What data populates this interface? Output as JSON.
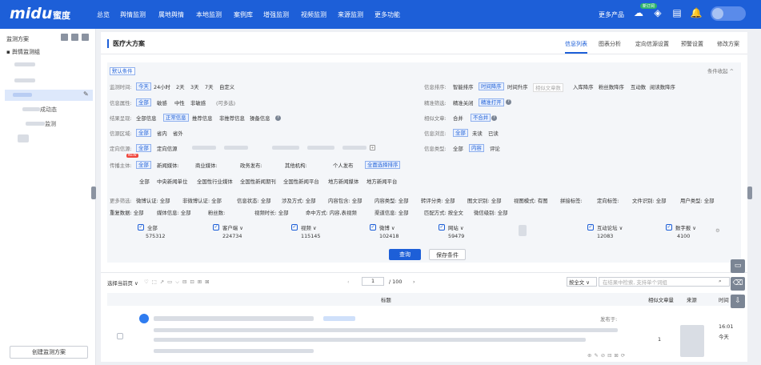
{
  "nav": {
    "logo": "midu",
    "logo_cn": "蜜度",
    "items": [
      "总览",
      "舆情监测",
      "属地舆情",
      "本地监测",
      "案例库",
      "增强监测",
      "视频监测",
      "来源监测",
      "更多功能"
    ],
    "more_products": "更多产品",
    "badge": "新订阅"
  },
  "sidebar": {
    "title": "监测方案",
    "group": "舆情监测组",
    "item_a": "成动态",
    "item_b": "监测",
    "create": "创建监测方案"
  },
  "main": {
    "title": "医疗大方案",
    "tabs": [
      "信息列表",
      "图表分析",
      "定向信源设置",
      "预警设置",
      "修改方案"
    ]
  },
  "filters": {
    "default": "默认条件",
    "collapse": "条件收起 ^",
    "time_label": "监测时间:",
    "time": [
      "今天",
      "24小时",
      "2天",
      "3天",
      "7天",
      "自定义"
    ],
    "attr_label": "信息属性:",
    "attr": [
      "全部",
      "敏感",
      "中性",
      "非敏感"
    ],
    "attr_hint": "(可多选)",
    "result_label": "结果呈现:",
    "result": [
      "全部信息",
      "正常信息",
      "推荐信息",
      "非推荐信息",
      "操备信息"
    ],
    "region_label": "信源区域:",
    "region": [
      "全部",
      "省内",
      "省外"
    ],
    "source_label": "定向信源:",
    "source": [
      "全部",
      "定向信源"
    ],
    "media_label": "传播主体:",
    "media": [
      "全部",
      "新闻媒体:",
      "商业媒体:",
      "政务发布:",
      "其他机构:",
      "个人发布"
    ],
    "media_new": "NEW",
    "media_tag": "全面选择排序",
    "media_sub": [
      "全部",
      "中央新闻单位",
      "全国性行业媒体",
      "全国性新闻期刊",
      "全国性新闻平台",
      "地方新闻媒体",
      "地方新闻平台"
    ],
    "sort_label": "信息排序:",
    "sort": [
      "智能排序",
      "时间降序",
      "时间升序",
      "相似文章数",
      "入库降序",
      "粉丝数降序",
      "互动数",
      "阅读数降序"
    ],
    "precise_label": "精准筛选:",
    "precise": [
      "精准关闭",
      "精准打开"
    ],
    "similar_label": "相似文章:",
    "similar": [
      "合并",
      "不合并"
    ],
    "read_label": "信息浏览:",
    "read": [
      "全部",
      "未读",
      "已读"
    ],
    "type_label": "信息类型:",
    "type": [
      "全部",
      "内容",
      "评论"
    ],
    "more_label": "更多筛选:",
    "more1": [
      "微博认证: 全部",
      "非微博认证: 全部",
      "信息状态: 全部",
      "涉及方式: 全部",
      "内容包含: 全部",
      "内容类型: 全部",
      "转评分类: 全部",
      "图文识别: 全部",
      "视图模式: 有图",
      "拼接标签:",
      "定向标签:",
      "文件识别: 全部",
      "用户类型: 全部"
    ],
    "more2": [
      "重复数据: 全部",
      "媒体信息: 全部",
      "粉丝数:",
      "视频时长: 全部",
      "命中方式: 内容,表视频",
      "渠道信息: 全部",
      "匹配方式: 按全文",
      "微信级别: 全部"
    ]
  },
  "channels": [
    {
      "name": "全部",
      "count": "575312"
    },
    {
      "name": "客户端 ∨",
      "count": "224734"
    },
    {
      "name": "视频 ∨",
      "count": "115145"
    },
    {
      "name": "微博 ∨",
      "count": "102418"
    },
    {
      "name": "网站 ∨",
      "count": "59479"
    },
    {
      "name": "互动论坛 ∨",
      "count": "12083"
    },
    {
      "name": "数字报 ∨",
      "count": "4100"
    }
  ],
  "actions": {
    "query": "查询",
    "save": "保存条件"
  },
  "toolbar": {
    "select": "选择当前页 ∨",
    "page": "1",
    "total": "/ 100",
    "search_scope": "按全文 ∨",
    "search_placeholder": "在结果中检索, 支持单个词组"
  },
  "table": {
    "col_title": "标题",
    "col_similar": "相似文章量",
    "col_source": "来源",
    "col_time": "时间"
  },
  "row": {
    "similar": "1",
    "time1": "16:01",
    "time2": "今天",
    "published": "发布于:"
  }
}
